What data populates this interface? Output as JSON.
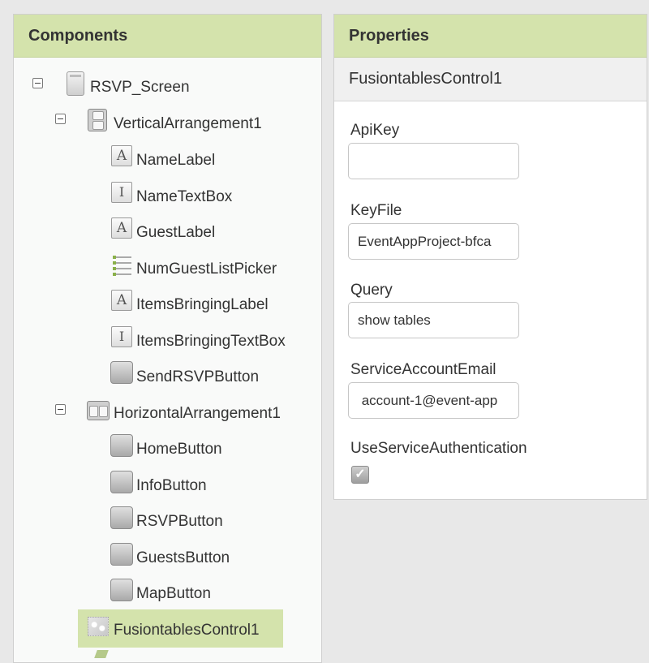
{
  "components": {
    "title": "Components",
    "tree": [
      {
        "label": "RSVP_Screen",
        "icon": "screen-icon"
      },
      {
        "label": "VerticalArrangement1",
        "icon": "vertical-arrangement-icon"
      },
      {
        "label": "NameLabel",
        "icon": "label-icon"
      },
      {
        "label": "NameTextBox",
        "icon": "textbox-icon"
      },
      {
        "label": "GuestLabel",
        "icon": "label-icon"
      },
      {
        "label": "NumGuestListPicker",
        "icon": "listpicker-icon"
      },
      {
        "label": "ItemsBringingLabel",
        "icon": "label-icon"
      },
      {
        "label": "ItemsBringingTextBox",
        "icon": "textbox-icon"
      },
      {
        "label": "SendRSVPButton",
        "icon": "button-icon"
      },
      {
        "label": "HorizontalArrangement1",
        "icon": "horizontal-arrangement-icon"
      },
      {
        "label": "HomeButton",
        "icon": "button-icon"
      },
      {
        "label": "InfoButton",
        "icon": "button-icon"
      },
      {
        "label": "RSVPButton",
        "icon": "button-icon"
      },
      {
        "label": "GuestsButton",
        "icon": "button-icon"
      },
      {
        "label": "MapButton",
        "icon": "button-icon"
      },
      {
        "label": "FusiontablesControl1",
        "icon": "fusiontables-icon",
        "selected": true
      }
    ]
  },
  "properties": {
    "title": "Properties",
    "component_name": "FusiontablesControl1",
    "fields": {
      "api_key": {
        "label": "ApiKey",
        "value": ""
      },
      "key_file": {
        "label": "KeyFile",
        "value": "EventAppProject-bfca"
      },
      "query": {
        "label": "Query",
        "value": "show tables"
      },
      "service_account_email": {
        "label": "ServiceAccountEmail",
        "value": " account-1@event-app"
      },
      "use_service_auth": {
        "label": "UseServiceAuthentication",
        "checked": true
      }
    }
  },
  "colors": {
    "header_green": "#d4e3ac",
    "selection_green": "#d4e3ac"
  }
}
